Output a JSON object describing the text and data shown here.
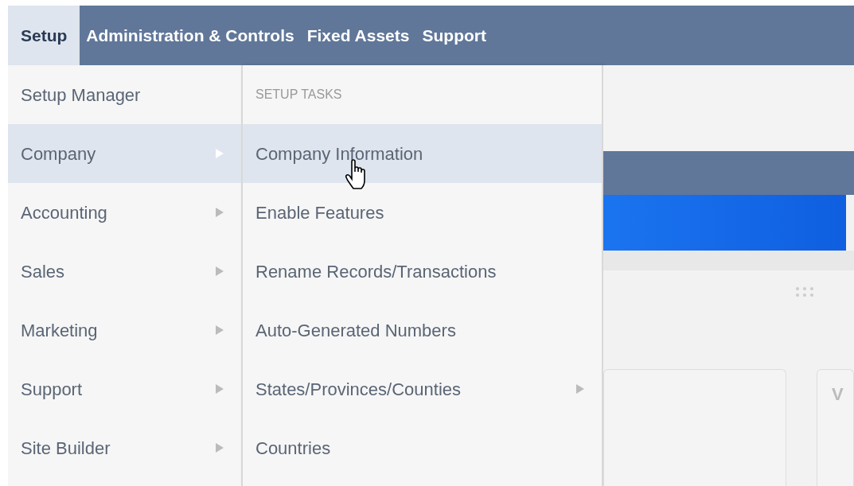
{
  "nav": {
    "tabs": [
      {
        "label": "Setup",
        "selected": true
      },
      {
        "label": "Administration & Controls",
        "selected": false
      },
      {
        "label": "Fixed Assets",
        "selected": false
      },
      {
        "label": "Support",
        "selected": false
      }
    ]
  },
  "menu": {
    "items": [
      {
        "label": "Setup Manager",
        "submenu": false,
        "selected": false
      },
      {
        "label": "Company",
        "submenu": true,
        "selected": true
      },
      {
        "label": "Accounting",
        "submenu": true,
        "selected": false
      },
      {
        "label": "Sales",
        "submenu": true,
        "selected": false
      },
      {
        "label": "Marketing",
        "submenu": true,
        "selected": false
      },
      {
        "label": "Support",
        "submenu": true,
        "selected": false
      },
      {
        "label": "Site Builder",
        "submenu": true,
        "selected": false
      }
    ]
  },
  "submenu": {
    "header": "SETUP TASKS",
    "items": [
      {
        "label": "Company Information",
        "submenu": false,
        "selected": true
      },
      {
        "label": "Enable Features",
        "submenu": false,
        "selected": false
      },
      {
        "label": "Rename Records/Transactions",
        "submenu": false,
        "selected": false
      },
      {
        "label": "Auto-Generated Numbers",
        "submenu": false,
        "selected": false
      },
      {
        "label": "States/Provinces/Counties",
        "submenu": true,
        "selected": false
      },
      {
        "label": "Countries",
        "submenu": false,
        "selected": false
      }
    ]
  },
  "background": {
    "card_label": "V"
  }
}
